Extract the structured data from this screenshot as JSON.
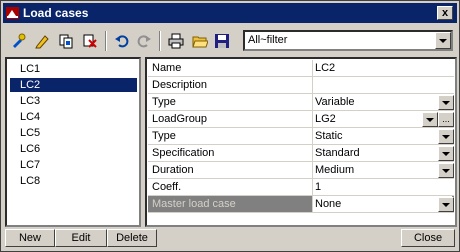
{
  "window": {
    "title": "Load cases",
    "close_label": "x"
  },
  "toolbar": {
    "icons": [
      "select-icon",
      "edit-icon",
      "copy-icon",
      "delete-icon",
      "undo-icon",
      "redo-icon",
      "print-icon",
      "open-folder-icon",
      "save-icon"
    ],
    "filter_value": "All~filter"
  },
  "list": {
    "items": [
      "LC1",
      "LC2",
      "LC3",
      "LC4",
      "LC5",
      "LC6",
      "LC7",
      "LC8"
    ],
    "selected": "LC2"
  },
  "properties": [
    {
      "name": "Name",
      "value": "LC2"
    },
    {
      "name": "Description",
      "value": ""
    },
    {
      "name": "Type",
      "value": "Variable"
    },
    {
      "name": "LoadGroup",
      "value": "LG2"
    },
    {
      "name": "Type",
      "value": "Static"
    },
    {
      "name": "Specification",
      "value": "Standard"
    },
    {
      "name": "Duration",
      "value": "Medium"
    },
    {
      "name": "Coeff.",
      "value": "1"
    },
    {
      "name": "Master load case",
      "value": "None"
    }
  ],
  "ellipsis_label": "...",
  "buttons": {
    "new": "New",
    "edit": "Edit",
    "delete": "Delete",
    "close": "Close"
  },
  "colors": {
    "selection": "#0a246a",
    "face": "#d4d0c8"
  }
}
